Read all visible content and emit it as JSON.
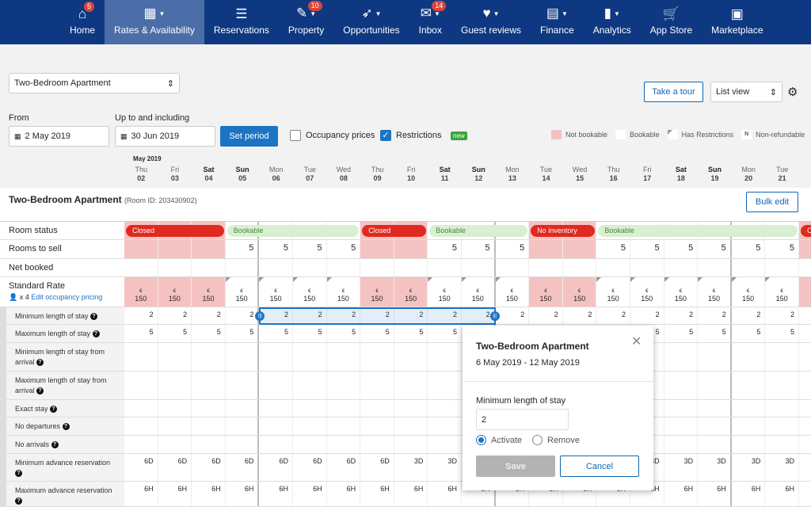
{
  "nav": [
    {
      "label": "Home",
      "icon": "home-icon",
      "glyph": "⌂",
      "badge": "5",
      "caret": false
    },
    {
      "label": "Rates & Availability",
      "icon": "calendar-icon",
      "glyph": "▦",
      "caret": true,
      "active": true
    },
    {
      "label": "Reservations",
      "icon": "list-icon",
      "glyph": "☰",
      "caret": false
    },
    {
      "label": "Property",
      "icon": "pencil-icon",
      "glyph": "✎",
      "badge": "10",
      "caret": true
    },
    {
      "label": "Opportunities",
      "icon": "rocket-icon",
      "glyph": "➶",
      "caret": true
    },
    {
      "label": "Inbox",
      "icon": "envelope-icon",
      "glyph": "✉",
      "badge": "14",
      "caret": true
    },
    {
      "label": "Guest reviews",
      "icon": "heart-icon",
      "glyph": "♥",
      "caret": true
    },
    {
      "label": "Finance",
      "icon": "ledger-icon",
      "glyph": "▤",
      "caret": true
    },
    {
      "label": "Analytics",
      "icon": "bar-chart-icon",
      "glyph": "▮",
      "caret": true
    },
    {
      "label": "App Store",
      "icon": "cart-icon",
      "glyph": "🛒",
      "caret": false
    },
    {
      "label": "Marketplace",
      "icon": "store-icon",
      "glyph": "▣",
      "caret": false
    }
  ],
  "room_select": "Two-Bedroom Apartment",
  "tour": "Take a tour",
  "view_select": "List view",
  "from_label": "From",
  "from_value": "2 May 2019",
  "to_label": "Up to and including",
  "to_value": "30 Jun 2019",
  "set_period": "Set period",
  "occupancy": "Occupancy prices",
  "restrictions": "Restrictions",
  "new_badge": "new",
  "legend": {
    "not_bookable": "Not bookable",
    "bookable": "Bookable",
    "has_restrictions": "Has Restrictions",
    "nonref_mark": "N",
    "nonref": "Non-refundable"
  },
  "month": "May 2019",
  "days": [
    [
      "Thu",
      "02"
    ],
    [
      "Fri",
      "03"
    ],
    [
      "Sat",
      "04"
    ],
    [
      "Sun",
      "05"
    ],
    [
      "Mon",
      "06"
    ],
    [
      "Tue",
      "07"
    ],
    [
      "Wed",
      "08"
    ],
    [
      "Thu",
      "09"
    ],
    [
      "Fri",
      "10"
    ],
    [
      "Sat",
      "11"
    ],
    [
      "Sun",
      "12"
    ],
    [
      "Mon",
      "13"
    ],
    [
      "Tue",
      "14"
    ],
    [
      "Wed",
      "15"
    ],
    [
      "Thu",
      "16"
    ],
    [
      "Fri",
      "17"
    ],
    [
      "Sat",
      "18"
    ],
    [
      "Sun",
      "19"
    ],
    [
      "Mon",
      "20"
    ],
    [
      "Tue",
      "21"
    ]
  ],
  "room": {
    "name": "Two-Bedroom Apartment",
    "id": "(Room ID: 203430902)",
    "bulk_edit": "Bulk edit"
  },
  "status_segments": [
    {
      "label": "Closed",
      "type": "closed",
      "from": 0,
      "to": 2
    },
    {
      "label": "Bookable",
      "type": "book",
      "from": 3,
      "to": 6
    },
    {
      "label": "Closed",
      "type": "closed",
      "from": 7,
      "to": 8
    },
    {
      "label": "Bookable",
      "type": "book",
      "from": 9,
      "to": 11
    },
    {
      "label": "No inventory",
      "type": "closed",
      "from": 12,
      "to": 13
    },
    {
      "label": "Bookable",
      "type": "book",
      "from": 14,
      "to": 19
    },
    {
      "label": "C",
      "type": "closed",
      "from": 20,
      "to": 20
    }
  ],
  "rows": {
    "room_status": "Room status",
    "rooms_to_sell": "Rooms to sell",
    "rooms_value": "5",
    "net_booked": "Net booked",
    "standard_rate": "Standard Rate",
    "occupancy_x": "x 4",
    "edit_occupancy": "Edit occupancy pricing",
    "currency": "€",
    "rate": "150"
  },
  "restriction_rows": [
    {
      "label": "Minimum length of stay",
      "values": [
        "2",
        "2",
        "2",
        "2",
        "2",
        "2",
        "2",
        "2",
        "2",
        "2",
        "2",
        "2",
        "2",
        "2",
        "2",
        "2",
        "2",
        "2",
        "2",
        "2"
      ]
    },
    {
      "label": "Maximum length of stay",
      "values": [
        "5",
        "5",
        "5",
        "5",
        "5",
        "5",
        "5",
        "5",
        "5",
        "5",
        "5",
        "5",
        "5",
        "5",
        "5",
        "5",
        "5",
        "5",
        "5",
        "5"
      ]
    },
    {
      "label": "Minimum length of stay from arrival",
      "values": []
    },
    {
      "label": "Maximum length of stay from arrival",
      "values": []
    },
    {
      "label": "Exact stay",
      "values": []
    },
    {
      "label": "No departures",
      "values": []
    },
    {
      "label": "No arrivals",
      "values": []
    },
    {
      "label": "Minimum advance reservation",
      "values": [
        "6D",
        "6D",
        "6D",
        "6D",
        "6D",
        "6D",
        "6D",
        "6D",
        "3D",
        "3D",
        "3D",
        "3D",
        "3D",
        "3D",
        "3D",
        "3D",
        "3D",
        "3D",
        "3D",
        "3D"
      ]
    },
    {
      "label": "Maximum advance reservation",
      "values": [
        "6H",
        "6H",
        "6H",
        "6H",
        "6H",
        "6H",
        "6H",
        "6H",
        "6H",
        "6H",
        "6H",
        "6H",
        "6H",
        "6H",
        "6H",
        "6H",
        "6H",
        "6H",
        "6H",
        "6H"
      ]
    }
  ],
  "popup": {
    "title": "Two-Bedroom Apartment",
    "range": "6 May 2019 - 12 May 2019",
    "field_label": "Minimum length of stay",
    "value": "2",
    "activate": "Activate",
    "remove": "Remove",
    "save": "Save",
    "cancel": "Cancel"
  },
  "colors": {
    "nav": "#0e3881",
    "accent": "#1c74c4",
    "closed": "#e0291f",
    "not_bookable": "#f5c2c2",
    "bookable": "#d8efd2"
  }
}
